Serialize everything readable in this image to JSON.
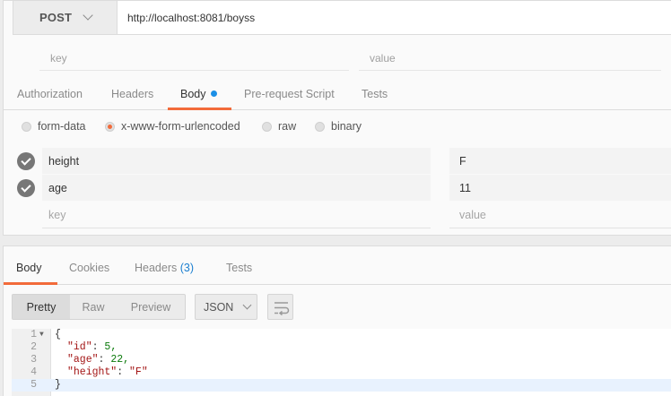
{
  "request": {
    "method": "POST",
    "url": "http://localhost:8081/boyss"
  },
  "params": {
    "key_placeholder": "key",
    "value_placeholder": "value"
  },
  "request_tabs": [
    {
      "label": "Authorization",
      "active": false
    },
    {
      "label": "Headers",
      "active": false
    },
    {
      "label": "Body",
      "active": true
    },
    {
      "label": "Pre-request Script",
      "active": false
    },
    {
      "label": "Tests",
      "active": false
    }
  ],
  "body_types": [
    {
      "label": "form-data",
      "selected": false
    },
    {
      "label": "x-www-form-urlencoded",
      "selected": true
    },
    {
      "label": "raw",
      "selected": false
    },
    {
      "label": "binary",
      "selected": false
    }
  ],
  "body_rows": [
    {
      "key": "height",
      "value": "F",
      "checked": true
    },
    {
      "key": "age",
      "value": "11",
      "checked": true
    }
  ],
  "body_placeholder": {
    "key": "key",
    "value": "value"
  },
  "response_tabs": [
    {
      "label": "Body",
      "active": true
    },
    {
      "label": "Cookies",
      "active": false
    },
    {
      "label": "Headers",
      "count": "(3)",
      "active": false
    },
    {
      "label": "Tests",
      "active": false
    }
  ],
  "view_modes": [
    {
      "label": "Pretty",
      "active": true
    },
    {
      "label": "Raw",
      "active": false
    },
    {
      "label": "Preview",
      "active": false
    }
  ],
  "format": "JSON",
  "wrap_icon": "wrap-lines-icon",
  "response_lines": [
    {
      "n": "1",
      "text": "{"
    },
    {
      "n": "2",
      "key": "\"id\"",
      "value": "5,",
      "vtype": "num"
    },
    {
      "n": "3",
      "key": "\"age\"",
      "value": "22,",
      "vtype": "num"
    },
    {
      "n": "4",
      "key": "\"height\"",
      "value": "\"F\"",
      "vtype": "str"
    },
    {
      "n": "5",
      "text": "}"
    }
  ],
  "colors": {
    "accent": "#f26b3a",
    "active_dot": "#1b8fe6",
    "count": "#1b7fd0"
  }
}
